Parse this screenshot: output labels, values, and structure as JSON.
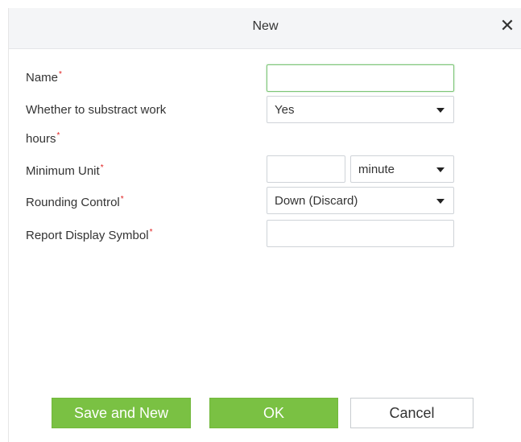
{
  "dialog": {
    "title": "New",
    "close_symbol": "✕"
  },
  "form": {
    "name_label": "Name",
    "subtract_label_line1": "Whether to substract work",
    "subtract_label_line2": "hours",
    "subtract_value": "Yes",
    "min_unit_label": "Minimum Unit",
    "min_unit_value": "",
    "min_unit_unit": "minute",
    "rounding_label": "Rounding Control",
    "rounding_value": "Down (Discard)",
    "report_symbol_label": "Report Display Symbol",
    "report_symbol_value": "",
    "required_mark": "*"
  },
  "buttons": {
    "save_new": "Save and New",
    "ok": "OK",
    "cancel": "Cancel"
  },
  "colors": {
    "accent_green": "#7ac143",
    "required_red": "#e02020",
    "focus_border": "#7cc576"
  },
  "icons": {
    "close": "close-icon",
    "dropdown": "chevron-down-icon"
  }
}
